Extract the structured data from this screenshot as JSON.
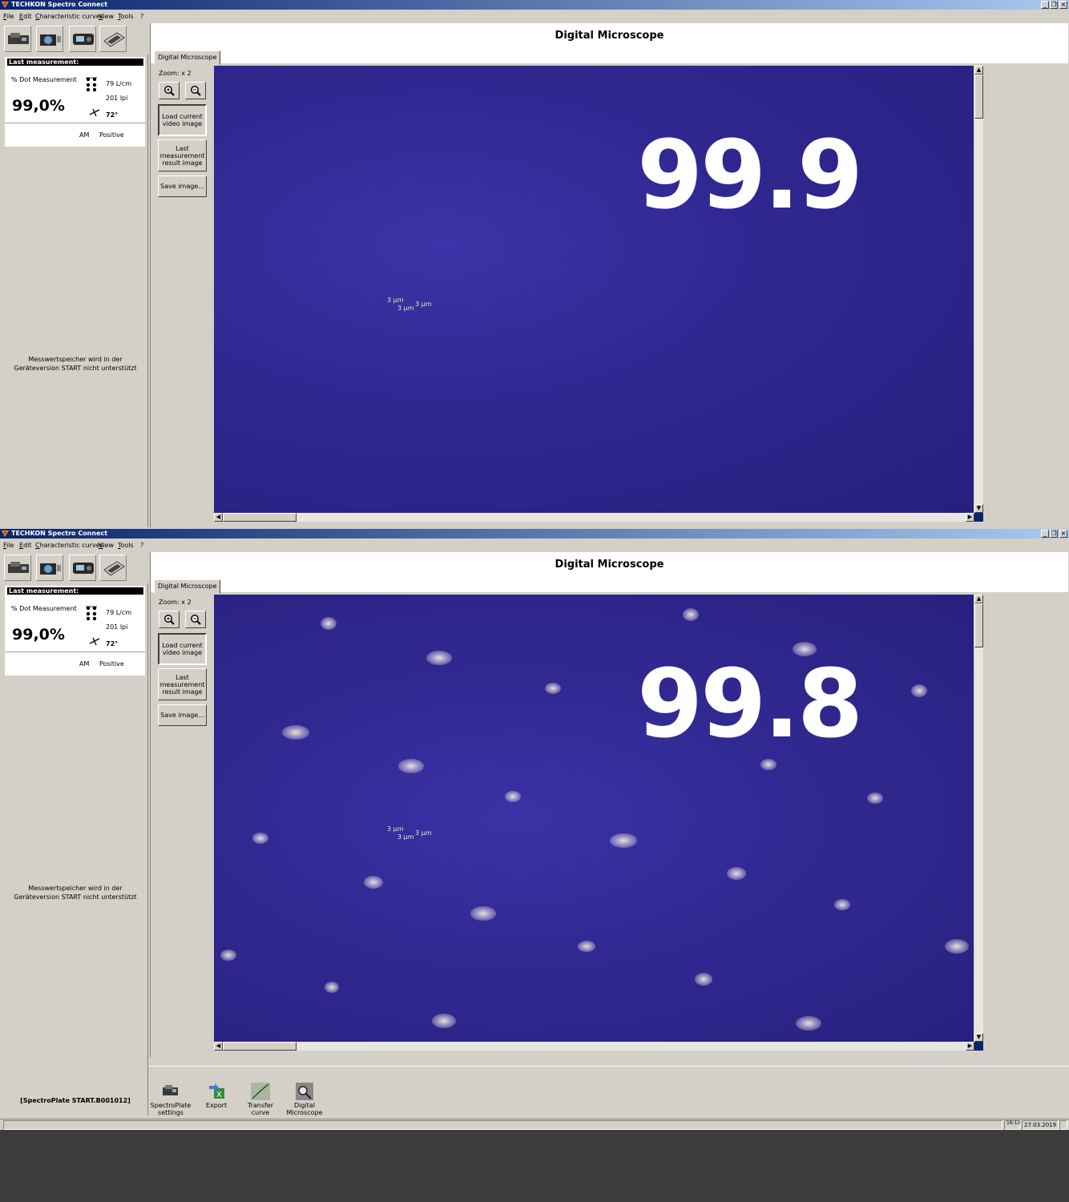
{
  "app": {
    "title": "TECHKON Spectro Connect",
    "window_controls": [
      "_",
      "❐",
      "×"
    ]
  },
  "menu": [
    "File",
    "Edit",
    "Characteristic curves",
    "View",
    "Tools",
    "?"
  ],
  "left": {
    "last_header": "Last measurement:",
    "mode": "% Dot Measurement",
    "value": "99,0%",
    "ruling_lcm": "79 L/cm",
    "ruling_lpi": "201 lpi",
    "angle": "72°",
    "screening": "AM",
    "polarity": "Positive",
    "note_line1": "Messwertspeicher wird in der",
    "note_line2": "Geräteversion  START nicht unterstützt"
  },
  "main": {
    "heading": "Digital Microscope",
    "tab": "Digital Microscope",
    "zoom_label": "Zoom:  x 2",
    "load_btn": "Load current video image",
    "last_btn": "Last measurement result image",
    "save_btn": "Save image...",
    "scale_a": "3 µm",
    "scale_b": "3 µm",
    "scale_c": "3 µm"
  },
  "shots": [
    {
      "overlay": "99.9"
    },
    {
      "overlay": "99.8"
    }
  ],
  "bottom": {
    "device_label": "[SpectroPlate START.B001012]",
    "items": [
      "SpectroPlate settings",
      "Export",
      "Transfer curve",
      "Digital Microscope"
    ]
  },
  "status": {
    "time": "16:12",
    "date": "27.03.2019"
  },
  "colors": {
    "titlebar_start": "#0a246a",
    "microscope_bg": "#2f278f",
    "overlay_text": "#ffffff"
  }
}
